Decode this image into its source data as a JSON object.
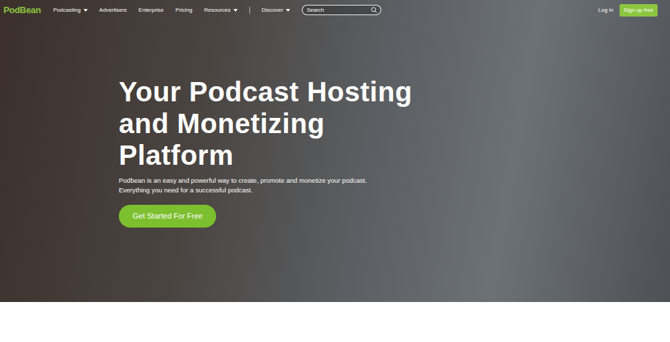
{
  "logo": "PodBean",
  "nav": {
    "items": [
      {
        "label": "Podcasting",
        "has_menu": true
      },
      {
        "label": "Advertisers",
        "has_menu": false
      },
      {
        "label": "Enterprise",
        "has_menu": false
      },
      {
        "label": "Pricing",
        "has_menu": false
      },
      {
        "label": "Resources",
        "has_menu": true
      }
    ],
    "discover": {
      "label": "Discover",
      "has_menu": true
    },
    "search": {
      "placeholder": "Search"
    },
    "login": "Log in",
    "signup": "Sign up free"
  },
  "hero": {
    "title_lines": [
      "Your Podcast Hosting",
      "and Monetizing",
      "Platform"
    ],
    "text": "Podbean is an easy and powerful way to create, promote and monetize your podcast. Everything you need for a successful podcast.",
    "cta": "Get Started For Free"
  }
}
